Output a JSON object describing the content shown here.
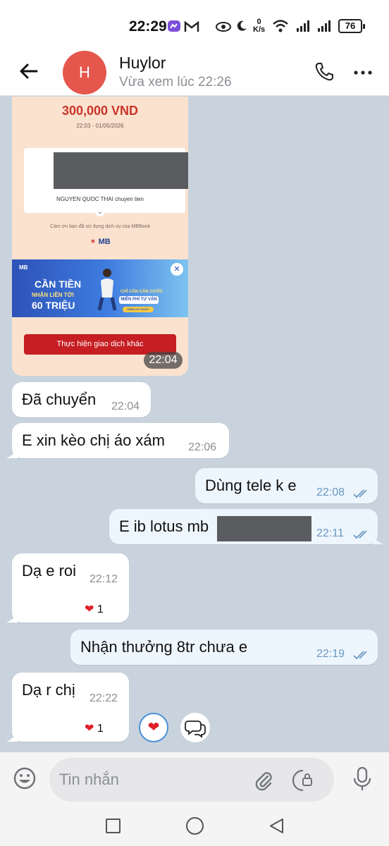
{
  "status_bar": {
    "time": "22:29",
    "net_speed_value": "0",
    "net_speed_unit": "K/s",
    "battery": "76"
  },
  "header": {
    "name": "Huylor",
    "avatar_letter": "H",
    "last_seen": "Vừa xem lúc 22:26"
  },
  "receipt": {
    "amount": "300,000 VND",
    "datetime": "22:03 - 01/05/2026",
    "recipient": "NGUYEN QUOC THAI chuyen tien",
    "thanks": "Cảm ơn bạn đã sử dụng dịch vụ của MBBank",
    "bank": "MB",
    "banner_logo": "MB",
    "banner_line1": "CẦN TIỀN",
    "banner_line2": "NHẬN LIỀN TỚI",
    "banner_line3": "60 TRIỆU",
    "banner_line4": "CHỈ CẦN CĂN CƯỚC",
    "banner_line5": "MIỄN PHÍ TƯ VẤN",
    "banner_line6": "ĐĂNG KÝ NGAY",
    "button": "Thực hiện giao dịch khác",
    "time": "22:04"
  },
  "messages": [
    {
      "direction": "in",
      "text": "Đã chuyển",
      "time": "22:04"
    },
    {
      "direction": "in",
      "text": "E xin kèo chị áo xám",
      "time": "22:06"
    },
    {
      "direction": "out",
      "text": "Dùng tele k e",
      "time": "22:08",
      "read": true
    },
    {
      "direction": "out",
      "text": "E ib lotus mb",
      "time": "22:11",
      "read": true
    },
    {
      "direction": "in",
      "text": "Dạ e roi",
      "time": "22:12",
      "reaction": "1"
    },
    {
      "direction": "out",
      "text": "Nhận thưởng 8tr chưa e",
      "time": "22:19",
      "read": true
    },
    {
      "direction": "in",
      "text": "Dạ r chị",
      "time": "22:22",
      "reaction": "1"
    }
  ],
  "input": {
    "placeholder": "Tin nhắn"
  },
  "colors": {
    "avatar": "#e5574c",
    "chat_background": "#c9d3dd",
    "outgoing_bubble": "#eef6fd",
    "tick_color": "#6a97c2"
  }
}
